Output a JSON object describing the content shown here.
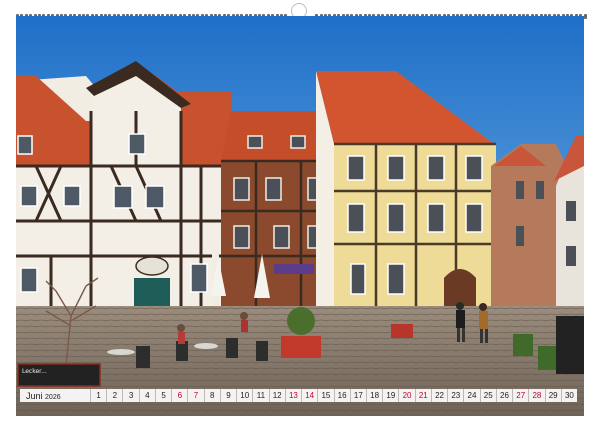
{
  "calendar": {
    "month": "Juni",
    "year": "2026",
    "days": [
      {
        "n": "1",
        "weekend": false
      },
      {
        "n": "2",
        "weekend": false
      },
      {
        "n": "3",
        "weekend": false
      },
      {
        "n": "4",
        "weekend": false
      },
      {
        "n": "5",
        "weekend": false
      },
      {
        "n": "6",
        "weekend": true
      },
      {
        "n": "7",
        "weekend": true
      },
      {
        "n": "8",
        "weekend": false
      },
      {
        "n": "9",
        "weekend": false
      },
      {
        "n": "10",
        "weekend": false
      },
      {
        "n": "11",
        "weekend": false
      },
      {
        "n": "12",
        "weekend": false
      },
      {
        "n": "13",
        "weekend": true
      },
      {
        "n": "14",
        "weekend": true
      },
      {
        "n": "15",
        "weekend": false
      },
      {
        "n": "16",
        "weekend": false
      },
      {
        "n": "17",
        "weekend": false
      },
      {
        "n": "18",
        "weekend": false
      },
      {
        "n": "19",
        "weekend": false
      },
      {
        "n": "20",
        "weekend": true
      },
      {
        "n": "21",
        "weekend": true
      },
      {
        "n": "22",
        "weekend": false
      },
      {
        "n": "23",
        "weekend": false
      },
      {
        "n": "24",
        "weekend": false
      },
      {
        "n": "25",
        "weekend": false
      },
      {
        "n": "26",
        "weekend": false
      },
      {
        "n": "27",
        "weekend": true
      },
      {
        "n": "28",
        "weekend": true
      },
      {
        "n": "29",
        "weekend": false
      },
      {
        "n": "30",
        "weekend": false
      }
    ]
  },
  "photo": {
    "cafe_sign": "Lecker...",
    "colors": {
      "sky": "#2f7fd0",
      "roof": "#d2552f",
      "timber": "#3a2a20",
      "plaster_yellow": "#eedb97",
      "brick": "#8b4a2e",
      "cobblestone": "#8a7d70",
      "weekend_red": "#c4002f"
    }
  }
}
